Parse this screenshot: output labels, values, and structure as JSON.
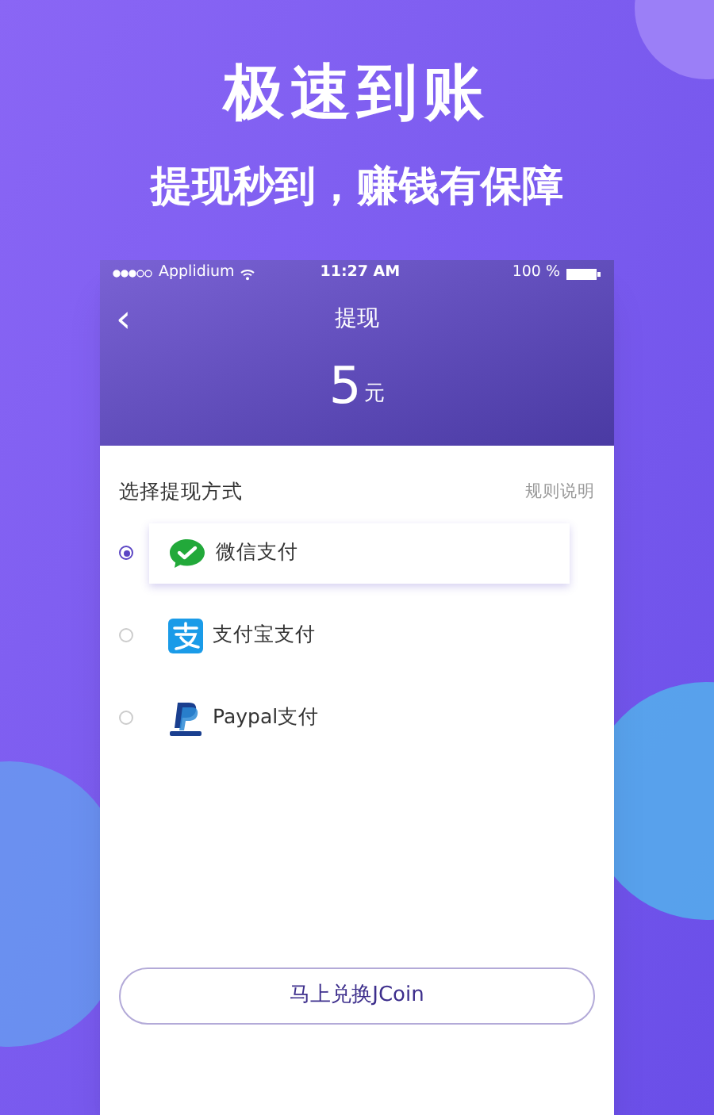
{
  "headline": "极速到账",
  "subheadline": "提现秒到，赚钱有保障",
  "status_bar": {
    "carrier": "Applidium",
    "time": "11:27 AM",
    "battery": "100 %"
  },
  "nav": {
    "back": "‹",
    "title": "提现"
  },
  "amount": {
    "value": "5",
    "unit": "元"
  },
  "section": {
    "title": "选择提现方式",
    "link": "规则说明"
  },
  "methods": [
    {
      "kind": "wechat",
      "label": "微信支付",
      "selected": true
    },
    {
      "kind": "alipay",
      "label": "支付宝支付",
      "selected": false
    },
    {
      "kind": "paypal",
      "label": "Paypal支付",
      "selected": false
    }
  ],
  "button": "马上兑换JCoin"
}
